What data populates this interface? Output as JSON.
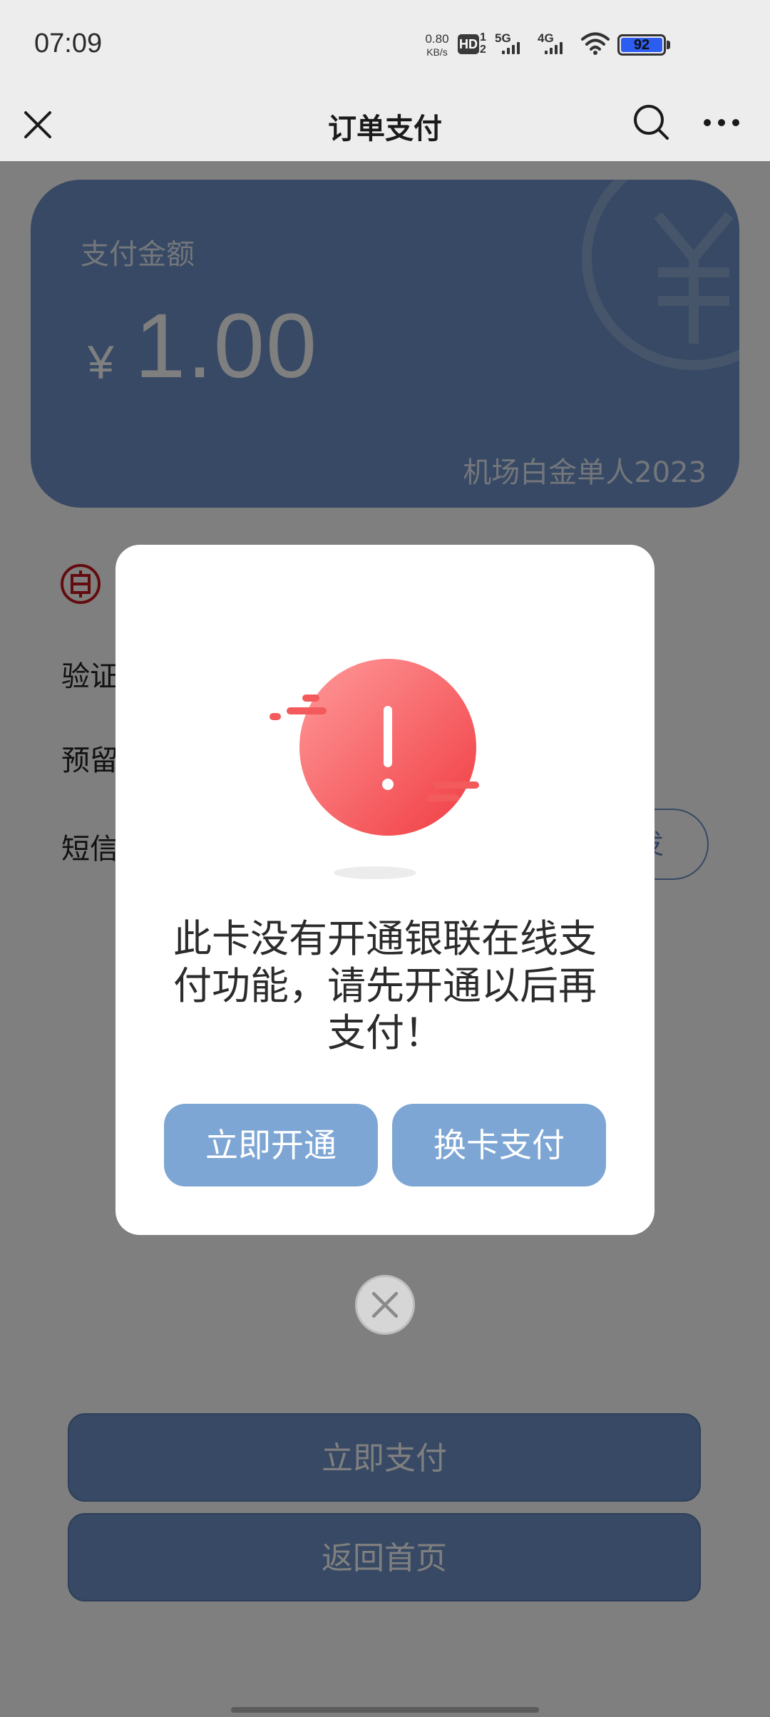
{
  "status_bar": {
    "time": "07:09",
    "net_speed_value": "0.80",
    "net_speed_unit": "KB/s",
    "hd_label": "HD",
    "hd_sim_top": "1",
    "hd_sim_bottom": "2",
    "sim1_label": "5G",
    "sim2_label": "4G",
    "battery_level": "92",
    "battery_color": "#2c5cf0"
  },
  "nav": {
    "title": "订单支付",
    "close_icon": "close-icon",
    "search_icon": "search-icon",
    "more_icon": "more-icon"
  },
  "card": {
    "label": "支付金额",
    "currency": "¥",
    "amount": "1.00",
    "product": "机场白金单人2023",
    "color": "#6f93c8"
  },
  "form": {
    "row_verify": "验证",
    "row_reserved": "预留",
    "row_sms": "短信",
    "resend_label": "发"
  },
  "buttons": {
    "pay_now": "立即支付",
    "back_home": "返回首页"
  },
  "dialog": {
    "message_lines": [
      "此卡没有开通银联在线支",
      "付功能，请先开通以后再",
      "支付！"
    ],
    "open_now": "立即开通",
    "switch_card": "换卡支付",
    "accent_color": "#f25a5c",
    "button_color": "#7ea6d4"
  }
}
